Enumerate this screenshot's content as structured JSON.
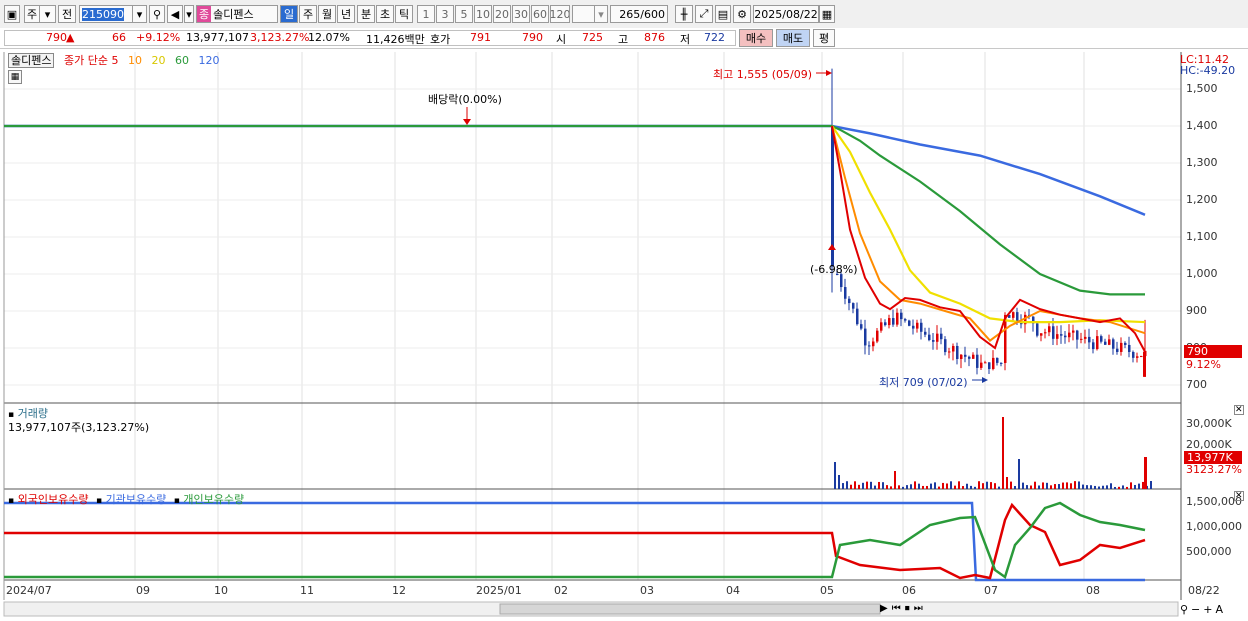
{
  "toolbar": {
    "market": "주",
    "period_prev": "전",
    "code": "215090",
    "name_prefix": "종",
    "name": "솔디펜스",
    "interval_day": "일",
    "interval_week": "주",
    "interval_month": "월",
    "interval_year": "년",
    "interval_min": "분",
    "interval_sec": "초",
    "interval_tick": "틱",
    "ticks": [
      "1",
      "3",
      "5",
      "10",
      "20",
      "30",
      "60",
      "120"
    ],
    "count": "265",
    "count_max": "/600",
    "date": "2025/08/22"
  },
  "quote": {
    "price": "790",
    "arrow": "▲",
    "change": "66",
    "change_pct": "+9.12%",
    "volume": "13,977,107",
    "volume_pct": "3,123.27%",
    "turnover": "12.07%",
    "amount": "11,426백만",
    "bid_label": "호가",
    "bid1": "791",
    "bid2": "790",
    "open_label": "시",
    "open": "725",
    "high_label": "고",
    "high": "876",
    "low_label": "저",
    "low": "722",
    "buy_label": "매수",
    "sell_label": "매도",
    "eval_label": "평"
  },
  "price_panel": {
    "stock_label": "솔디펜스",
    "ma_title": "종가 단순",
    "ma_periods": [
      "5",
      "10",
      "20",
      "60",
      "120"
    ],
    "dividend_note": "배당락(0.00%)",
    "high_note": "최고 1,555 (05/09)",
    "low_note": "최저 709 (07/02)",
    "pct_note": "(-6.98%)",
    "lc": "LC:11.42",
    "hc": "HC:-49.20",
    "y_ticks": [
      "1,500",
      "1,400",
      "1,300",
      "1,200",
      "1,100",
      "1,000",
      "900",
      "800",
      "700"
    ],
    "price_tag": "790",
    "pct_tag": "9.12%"
  },
  "volume_panel": {
    "title": "거래량",
    "summary": "13,977,107주(3,123.27%)",
    "y_ticks": [
      "30,000K",
      "20,000K"
    ],
    "tag": "13,977K",
    "pct_tag": "3123.27%"
  },
  "holding_panel": {
    "legend": [
      "외국인보유수량",
      "기관보유수량",
      "개인보유수량"
    ],
    "y_ticks": [
      "1,500,000",
      "1,000,000",
      "500,000"
    ]
  },
  "x_axis": [
    "2024/07",
    "09",
    "10",
    "11",
    "12",
    "2025/01",
    "02",
    "03",
    "04",
    "05",
    "06",
    "07",
    "08",
    "08/22"
  ],
  "colors": {
    "ma5": "#e00000",
    "ma10": "#ff8c00",
    "ma20": "#f0e000",
    "ma60": "#2a9a3a",
    "ma120": "#3a6ae0",
    "up": "#e00000",
    "down": "#1a3aa0"
  }
}
